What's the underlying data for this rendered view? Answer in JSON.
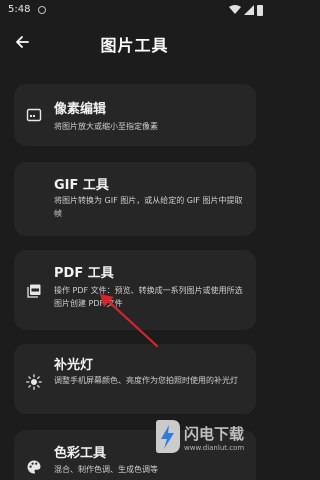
{
  "status_bar": {
    "time": "5:48"
  },
  "app_bar": {
    "title": "图片工具",
    "back_icon": "arrow-left-icon"
  },
  "tools": [
    {
      "icon": "pixel-edit-icon",
      "title": "像素编辑",
      "description": "将图片放大或缩小至指定像素"
    },
    {
      "icon": "gif-icon",
      "title": "GIF 工具",
      "description": "将图片转换为 GIF 图片，或从给定的 GIF 图片中提取帧"
    },
    {
      "icon": "pdf-icon",
      "title": "PDF 工具",
      "description": "操作 PDF 文件：预览、转换成一系列图片或使用所选图片创建 PDF 文件"
    },
    {
      "icon": "sun-icon",
      "title": "补光灯",
      "description": "调整手机屏幕颜色、亮度作为您拍照时使用的补光灯"
    },
    {
      "icon": "palette-icon",
      "title": "色彩工具",
      "description": "混合、制作色调、生成色调等"
    }
  ],
  "watermark": {
    "name": "闪电下载",
    "url": "www.dianlut.com",
    "logo_icon": "lightning-logo-icon"
  },
  "colors": {
    "background": "#1c1c1c",
    "card": "#262626",
    "annotation_arrow": "#d9232d"
  }
}
